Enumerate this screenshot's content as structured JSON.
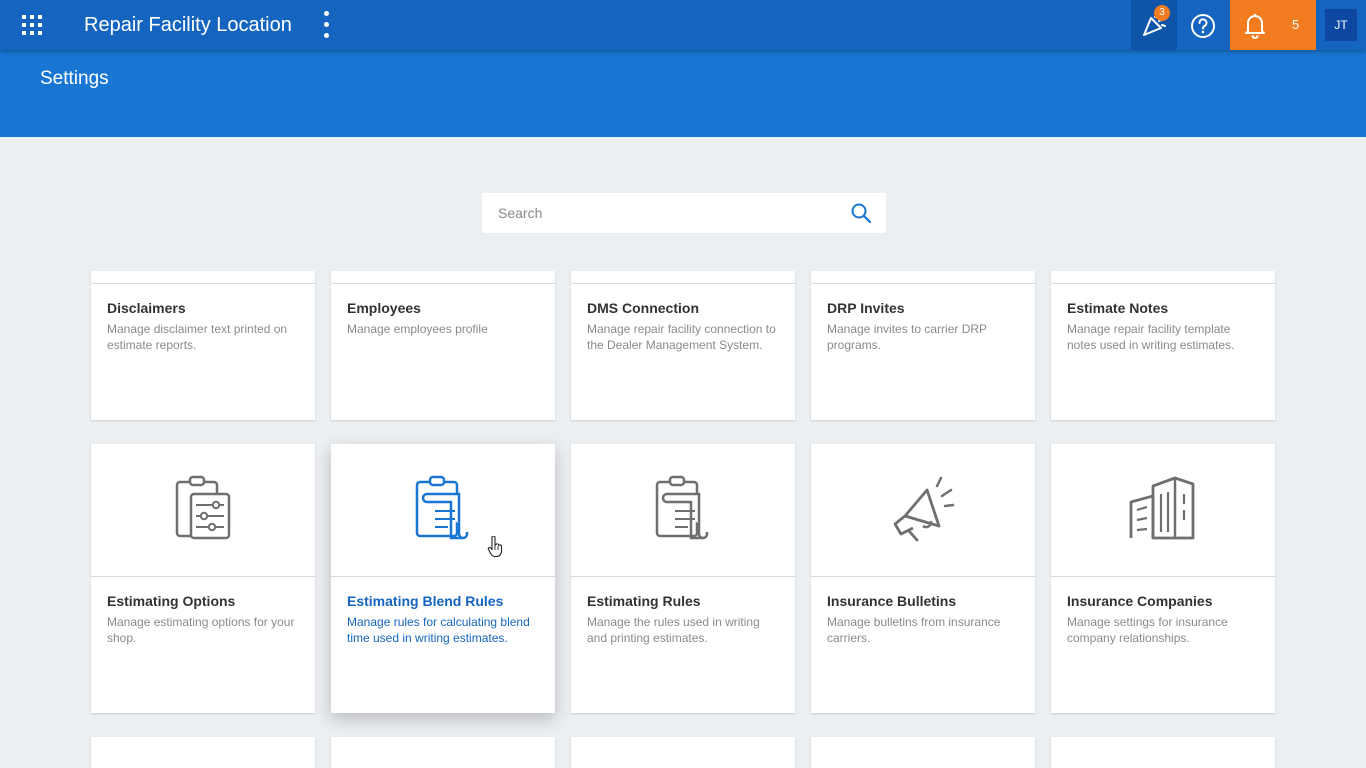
{
  "header": {
    "title": "Repair Facility Location",
    "celebration_badge": "3",
    "notification_count": "5",
    "avatar_initials": "JT"
  },
  "page": {
    "title": "Settings"
  },
  "search": {
    "placeholder": "Search",
    "value": ""
  },
  "colors": {
    "topbar": "#1565c0",
    "subheader": "#1976d2",
    "accent": "#f47c20",
    "icon_gray": "#6f6f6f",
    "icon_active": "#1976d2"
  },
  "cards_row1": [
    {
      "title": "Disclaimers",
      "desc": "Manage disclaimer text printed on estimate reports."
    },
    {
      "title": "Employees",
      "desc": "Manage employees profile"
    },
    {
      "title": "DMS Connection",
      "desc": "Manage repair facility connection to the Dealer Management System."
    },
    {
      "title": "DRP Invites",
      "desc": "Manage invites to carrier DRP programs."
    },
    {
      "title": "Estimate Notes",
      "desc": "Manage repair facility template notes used in writing estimates."
    }
  ],
  "cards_row2": [
    {
      "title": "Estimating Options",
      "desc": "Manage estimating options for your shop.",
      "icon": "clipboard-sliders-icon"
    },
    {
      "title": "Estimating Blend Rules",
      "desc": "Manage rules for calculating blend time used in writing  estimates.",
      "icon": "clipboard-document-icon"
    },
    {
      "title": "Estimating Rules",
      "desc": "Manage the rules used in writing and printing estimates.",
      "icon": "clipboard-document-icon"
    },
    {
      "title": "Insurance Bulletins",
      "desc": "Manage bulletins from insurance carriers.",
      "icon": "megaphone-icon"
    },
    {
      "title": "Insurance Companies",
      "desc": "Manage settings for insurance company relationships.",
      "icon": "buildings-icon"
    }
  ]
}
